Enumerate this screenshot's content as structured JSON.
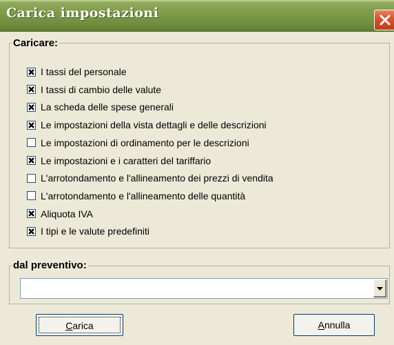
{
  "window": {
    "title": "Carica impostazioni"
  },
  "load_group": {
    "label": "Caricare:",
    "items": [
      {
        "label": "I tassi del personale",
        "checked": true
      },
      {
        "label": "I tassi di cambio delle valute",
        "checked": true
      },
      {
        "label": "La scheda delle spese generali",
        "checked": true
      },
      {
        "label": "Le impostazioni della vista dettagli e delle descrizioni",
        "checked": true
      },
      {
        "label": "Le impostazioni di ordinamento per le descrizioni",
        "checked": false
      },
      {
        "label": "Le impostazioni e i caratteri del tariffario",
        "checked": true
      },
      {
        "label": "L'arrotondamento e l'allineamento dei prezzi di vendita",
        "checked": false
      },
      {
        "label": "L'arrotondamento e l'allineamento delle quantità",
        "checked": false
      },
      {
        "label": "Aliquota IVA",
        "checked": true
      },
      {
        "label": "I tipi e le valute predefiniti",
        "checked": true
      }
    ]
  },
  "source_group": {
    "label": "dal preventivo:",
    "selected_value": ""
  },
  "buttons": {
    "load": {
      "label": "Carica",
      "mnemonic": "C",
      "rest": "arica"
    },
    "cancel": {
      "label": "Annulla",
      "mnemonic": "A",
      "rest": "nnulla"
    }
  }
}
